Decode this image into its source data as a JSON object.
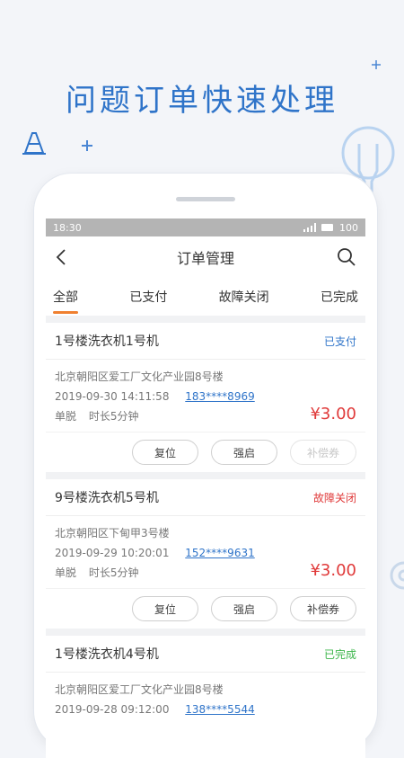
{
  "headline": "问题订单快速处理",
  "status_bar": {
    "time": "18:30",
    "battery": "100"
  },
  "nav": {
    "title": "订单管理",
    "back_icon": "chevron-left-icon",
    "search_icon": "search-icon"
  },
  "tabs": [
    "全部",
    "已支付",
    "故障关闭",
    "已完成"
  ],
  "colors": {
    "accent": "#2f74c9",
    "price": "#e03a3a",
    "paid": "#2f74c9",
    "fault": "#e03a3a",
    "done": "#3bb54a",
    "tab_indicator": "#f08030"
  },
  "orders": [
    {
      "title": "1号楼洗衣机1号机",
      "status": "已支付",
      "address": "北京朝阳区爱工厂文化产业园8号楼",
      "datetime": "2019-09-30 14:11:58",
      "phone": "183****8969",
      "mode": "单脱",
      "duration": "时长5分钟",
      "price": "¥3.00",
      "actions": [
        "复位",
        "强启",
        "补偿券"
      ]
    },
    {
      "title": "9号楼洗衣机5号机",
      "status": "故障关闭",
      "address": "北京朝阳区下甸甲3号楼",
      "datetime": "2019-09-29 10:20:01",
      "phone": "152****9631",
      "mode": "单脱",
      "duration": "时长5分钟",
      "price": "¥3.00",
      "actions": [
        "复位",
        "强启",
        "补偿券"
      ]
    },
    {
      "title": "1号楼洗衣机4号机",
      "status": "已完成",
      "address": "北京朝阳区爱工厂文化产业园8号楼",
      "datetime": "2019-09-28 09:12:00",
      "phone": "138****5544"
    }
  ]
}
